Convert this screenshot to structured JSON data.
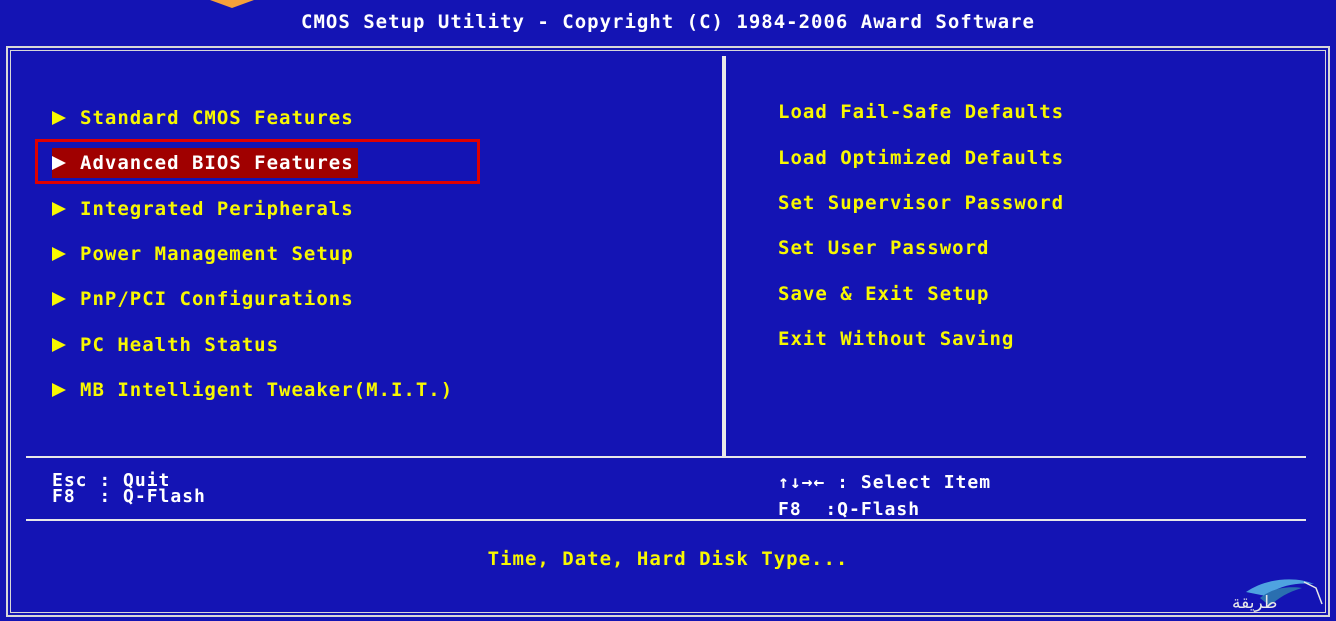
{
  "title": "CMOS Setup Utility - Copyright  (C)  1984-2006 Award Software",
  "left_menu": [
    {
      "label": "Standard CMOS Features",
      "selected": false
    },
    {
      "label": "Advanced BIOS Features",
      "selected": true
    },
    {
      "label": "Integrated Peripherals",
      "selected": false
    },
    {
      "label": "Power Management Setup",
      "selected": false
    },
    {
      "label": "PnP/PCI Configurations",
      "selected": false
    },
    {
      "label": "PC Health Status",
      "selected": false
    },
    {
      "label": "MB Intelligent Tweaker(M.I.T.)",
      "selected": false
    }
  ],
  "right_menu": [
    {
      "label": "Load Fail-Safe Defaults"
    },
    {
      "label": "Load Optimized Defaults"
    },
    {
      "label": "Set Supervisor Password"
    },
    {
      "label": "Set User Password"
    },
    {
      "label": "Save & Exit Setup"
    },
    {
      "label": "Exit Without Saving"
    }
  ],
  "help": {
    "left_line1": "Esc : Quit",
    "left_line2": "F8  : Q-Flash",
    "right_line1": "↑↓→← : Select Item",
    "right_line2": "F8  :Q-Flash"
  },
  "description": "Time, Date, Hard Disk Type...",
  "watermark": "طريقة",
  "colors": {
    "background": "#1414b4",
    "menu_text": "#f8f800",
    "selection": "#a00000",
    "highlight_box": "#e00000",
    "border": "#d8d8d8"
  }
}
